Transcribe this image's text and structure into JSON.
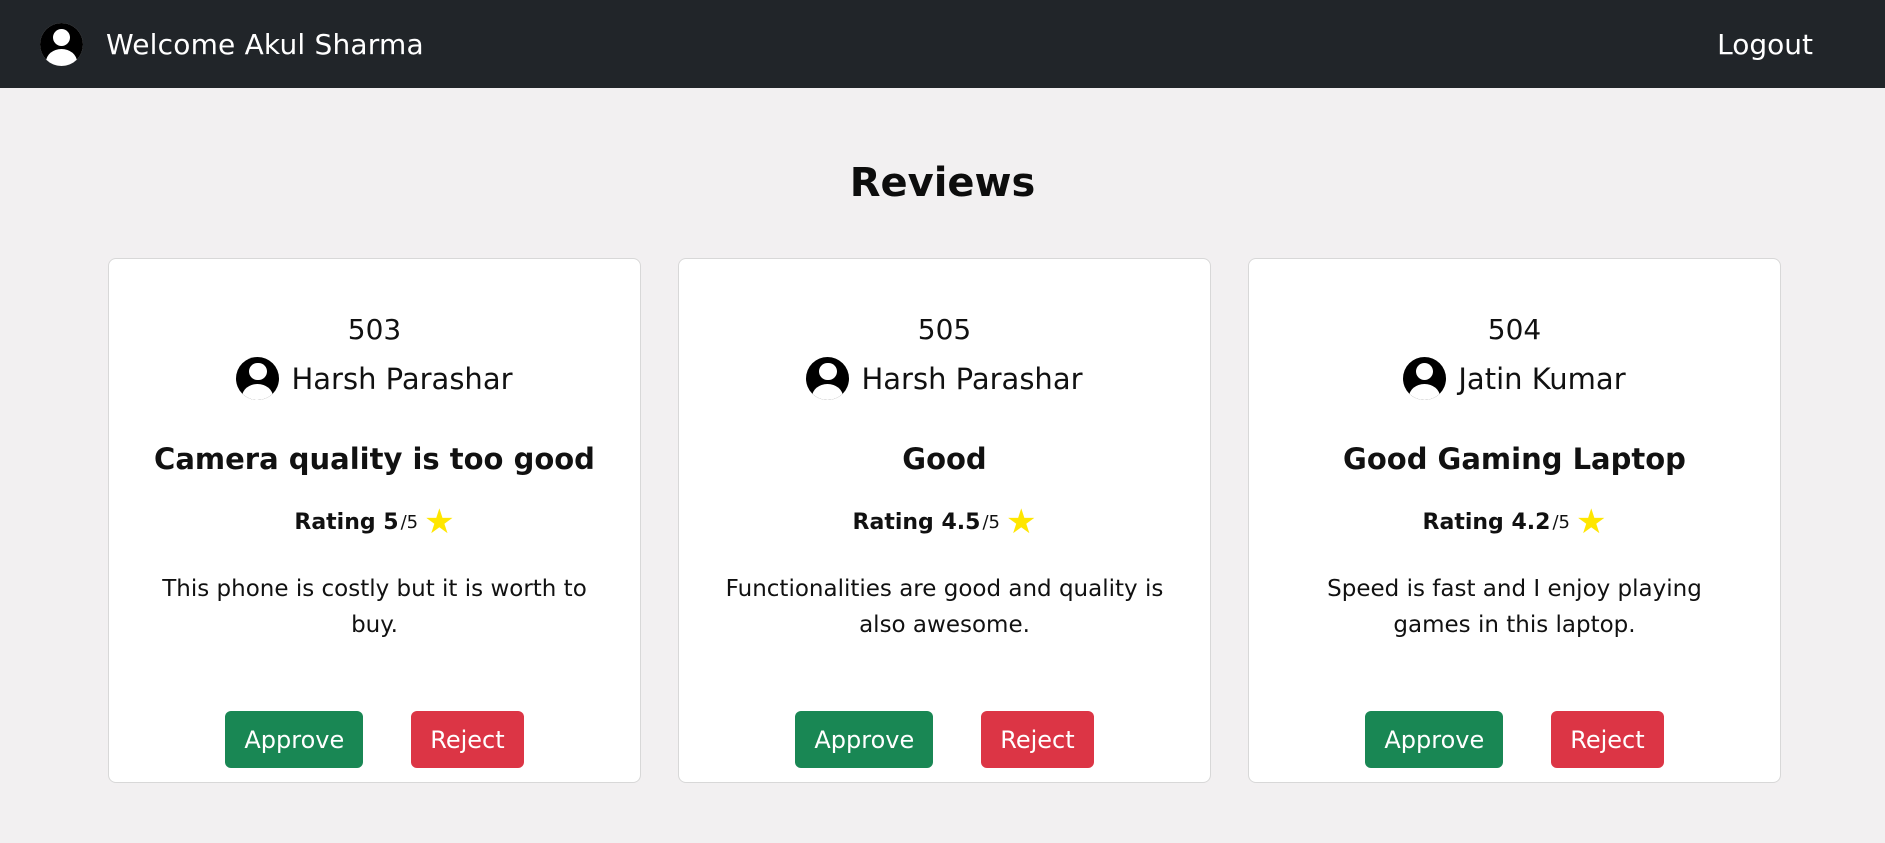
{
  "navbar": {
    "welcome_text": "Welcome Akul Sharma",
    "logout_label": "Logout",
    "avatar_icon": "user-circle-icon"
  },
  "page": {
    "title": "Reviews"
  },
  "colors": {
    "navbar_bg": "#212529",
    "page_bg": "#f2f0f1",
    "approve": "#198754",
    "reject": "#dc3545",
    "star": "#ffe600"
  },
  "reviews": [
    {
      "id": "503",
      "user": "Harsh Parashar",
      "title": "Camera quality is too good",
      "rating_prefix": "Rating 5 ",
      "rating_out": "/5",
      "body": "This phone is costly but it is worth to buy.",
      "approve_label": "Approve",
      "reject_label": "Reject"
    },
    {
      "id": "505",
      "user": "Harsh Parashar",
      "title": "Good",
      "rating_prefix": "Rating 4.5 ",
      "rating_out": "/5",
      "body": "Functionalities are good and quality is also awesome.",
      "approve_label": "Approve",
      "reject_label": "Reject"
    },
    {
      "id": "504",
      "user": "Jatin Kumar",
      "title": "Good Gaming Laptop",
      "rating_prefix": "Rating 4.2 ",
      "rating_out": "/5",
      "body": "Speed is fast and I enjoy playing games in this laptop.",
      "approve_label": "Approve",
      "reject_label": "Reject"
    }
  ]
}
